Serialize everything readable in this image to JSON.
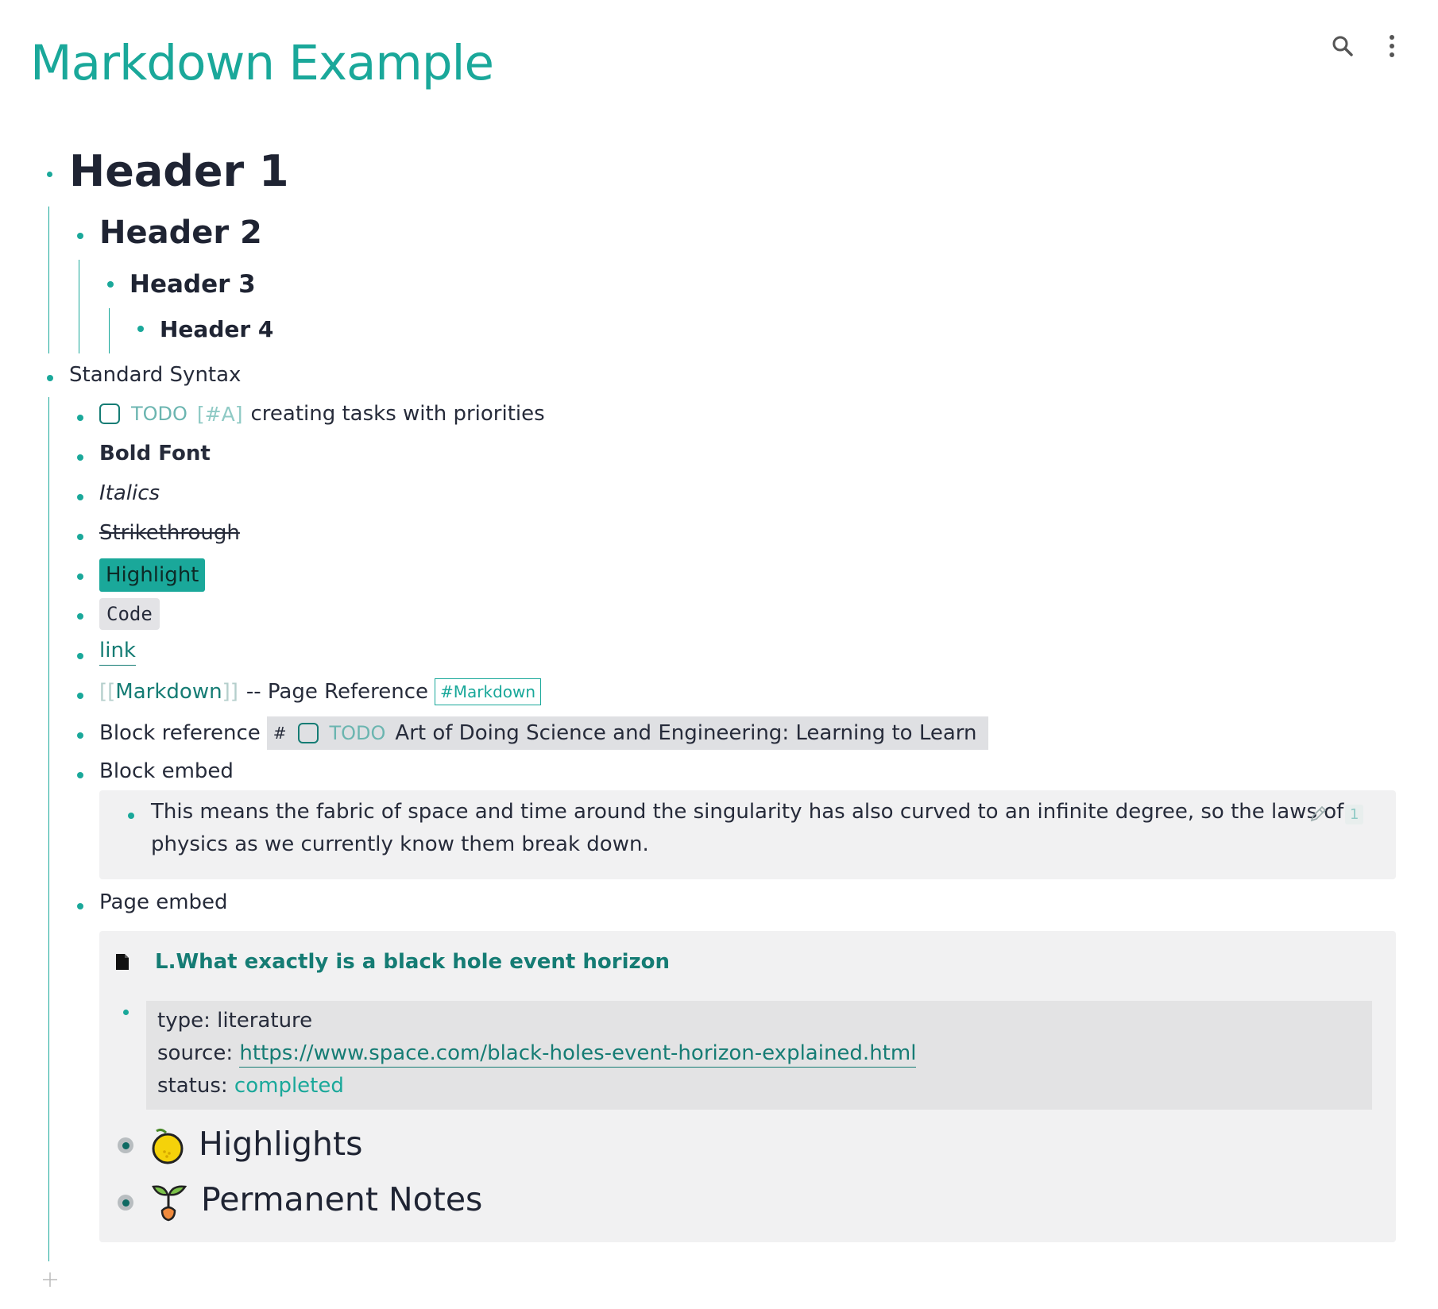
{
  "page": {
    "title": "Markdown Example"
  },
  "headers": {
    "h1": "Header 1",
    "h2": "Header 2",
    "h3": "Header 3",
    "h4": "Header 4"
  },
  "standard": {
    "label": "Standard Syntax",
    "todo_marker": "TODO",
    "priority": "[#A]",
    "todo_text": "creating tasks with priorities",
    "bold": "Bold Font",
    "italic": "Italics",
    "strike": "Strikethrough",
    "highlight": "Highlight",
    "code": "Code",
    "link": "link",
    "pageref_open": "[[",
    "pageref": "Markdown",
    "pageref_close": "]]",
    "pageref_suffix": "-- Page Reference",
    "tag": "#Markdown",
    "blockref_label": "Block reference",
    "blockref_hash": "#",
    "blockref_todo": "TODO",
    "blockref_text": "Art of Doing Science and Engineering: Learning to Learn",
    "block_embed_label": "Block embed",
    "block_embed_line1": "This means the fabric of space and time around the singularity has also curved to an infinite degree, so the laws of",
    "block_embed_line2": "physics as we currently know them break down.",
    "block_embed_refs": "1",
    "page_embed_label": "Page embed"
  },
  "page_embed": {
    "title": "L.What exactly is a black hole event horizon",
    "type_key": "type:",
    "type_val": "literature",
    "source_key": "source:",
    "source_val": "https://www.space.com/black-holes-event-horizon-explained.html",
    "status_key": "status:",
    "status_val": "completed",
    "highlights": "Highlights",
    "permanent": "Permanent Notes"
  },
  "colors": {
    "accent": "#1aa89a",
    "accent_dark": "#157c74",
    "text": "#262b3a"
  }
}
